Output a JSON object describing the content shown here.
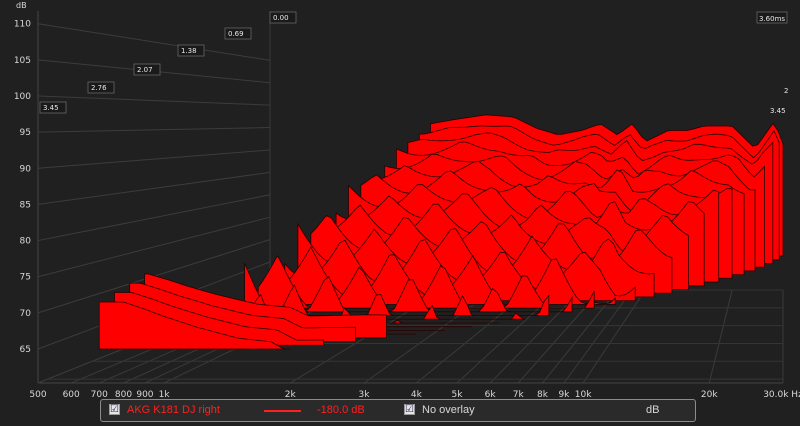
{
  "chart_data": {
    "type": "area",
    "y_unit": "dB",
    "x_unit": "Hz",
    "x_scale": "log",
    "y_ticks": [
      65,
      70,
      75,
      80,
      85,
      90,
      95,
      100,
      105,
      110
    ],
    "x_ticks": [
      500,
      600,
      700,
      800,
      900,
      1000,
      2000,
      3000,
      4000,
      5000,
      6000,
      7000,
      8000,
      9000,
      10000,
      20000,
      30000
    ],
    "x_tick_labels": [
      "500",
      "600",
      "700",
      "800",
      "900",
      "1k",
      "2k",
      "3k",
      "4k",
      "5k",
      "6k",
      "7k",
      "8k",
      "9k",
      "10k",
      "20k",
      "30.0k Hz"
    ],
    "time_ticks": [
      0.0,
      0.69,
      1.38,
      2.07,
      2.76,
      3.45
    ],
    "time_tick_labels": [
      "0.00",
      "0.69",
      "1.38",
      "2.07",
      "2.76",
      "3.45"
    ],
    "time_end_label": "3.60ms",
    "right_edge_labels": [
      "3.45",
      "2"
    ],
    "series_color": "#ff0000",
    "back_slice_db": {
      "freq_hz": [
        1800,
        2200,
        2800,
        3500,
        4200,
        5000,
        6000,
        7000,
        8000,
        9000,
        10000,
        12000,
        14000,
        16000,
        20000,
        24000,
        28000,
        30000
      ],
      "db": [
        94.5,
        95.5,
        96.5,
        96,
        93.5,
        92,
        93,
        94.5,
        92,
        94.5,
        90.5,
        93,
        93,
        94,
        94,
        89,
        95,
        90
      ]
    },
    "front_slice_db": {
      "freq_hz": [
        700,
        800,
        900,
        1000,
        1200,
        1500,
        1800,
        2000
      ],
      "db": [
        71.5,
        71.5,
        70.5,
        69.5,
        68,
        66.5,
        66,
        64.5
      ]
    }
  },
  "legend": {
    "series_checked": "☑",
    "series_name": "AKG K181 DJ right",
    "series_value": "-180.0 dB",
    "overlay_checked": "☑",
    "overlay_label": "No overlay",
    "unit_label": "dB"
  }
}
